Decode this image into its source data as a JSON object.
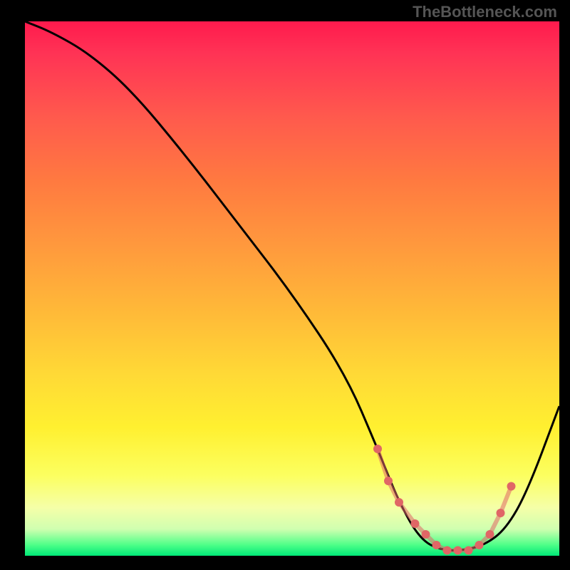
{
  "watermark": "TheBottleneck.com",
  "chart_data": {
    "type": "line",
    "title": "",
    "xlabel": "",
    "ylabel": "",
    "xlim": [
      0,
      100
    ],
    "ylim": [
      0,
      100
    ],
    "series": [
      {
        "name": "bottleneck-curve",
        "x": [
          0,
          5,
          12,
          20,
          30,
          40,
          50,
          60,
          66,
          70,
          74,
          78,
          82,
          86,
          90,
          94,
          100
        ],
        "values": [
          100,
          98,
          94,
          87,
          75,
          62,
          49,
          34,
          20,
          10,
          3,
          1,
          1,
          2,
          5,
          12,
          28
        ]
      }
    ],
    "markers": {
      "name": "optimal-range",
      "color": "#e06666",
      "points_x": [
        66,
        68,
        70,
        73,
        75,
        77,
        79,
        81,
        83,
        85,
        87,
        89,
        91
      ],
      "points_y": [
        20,
        14,
        10,
        6,
        4,
        2,
        1,
        1,
        1,
        2,
        4,
        8,
        13
      ]
    },
    "background_gradient": {
      "top": "#ff1a4d",
      "mid": "#ffd936",
      "bottom": "#00e877"
    }
  }
}
